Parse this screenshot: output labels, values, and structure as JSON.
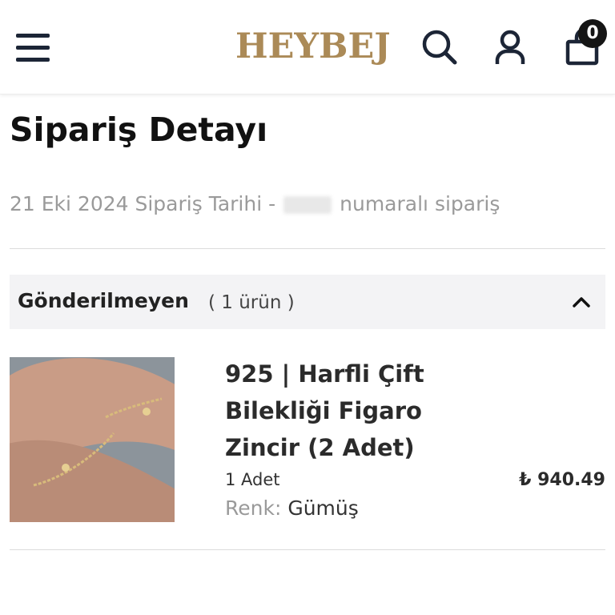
{
  "header": {
    "logo": "HEYBEJ",
    "cart_count": "0",
    "icons": {
      "menu": "hamburger-icon",
      "search": "search-icon",
      "account": "user-icon",
      "cart": "shopping-bag-icon"
    },
    "brand_color": "#ab8a57"
  },
  "page": {
    "title": "Sipariş Detayı",
    "order_date": "21 Eki 2024 Sipariş Tarihi -",
    "order_suffix": "numaralı sipariş"
  },
  "group": {
    "title": "Gönderilmeyen",
    "count": "( 1 ürün )",
    "icon": "chevron-up-icon"
  },
  "items": [
    {
      "name": "925 | Harfli Çift Bilekliği Figaro Zincir (2 Adet)",
      "quantity": "1 Adet",
      "color_label": "Renk:",
      "color_value": "Gümüş",
      "price": "₺ 940.49"
    }
  ]
}
